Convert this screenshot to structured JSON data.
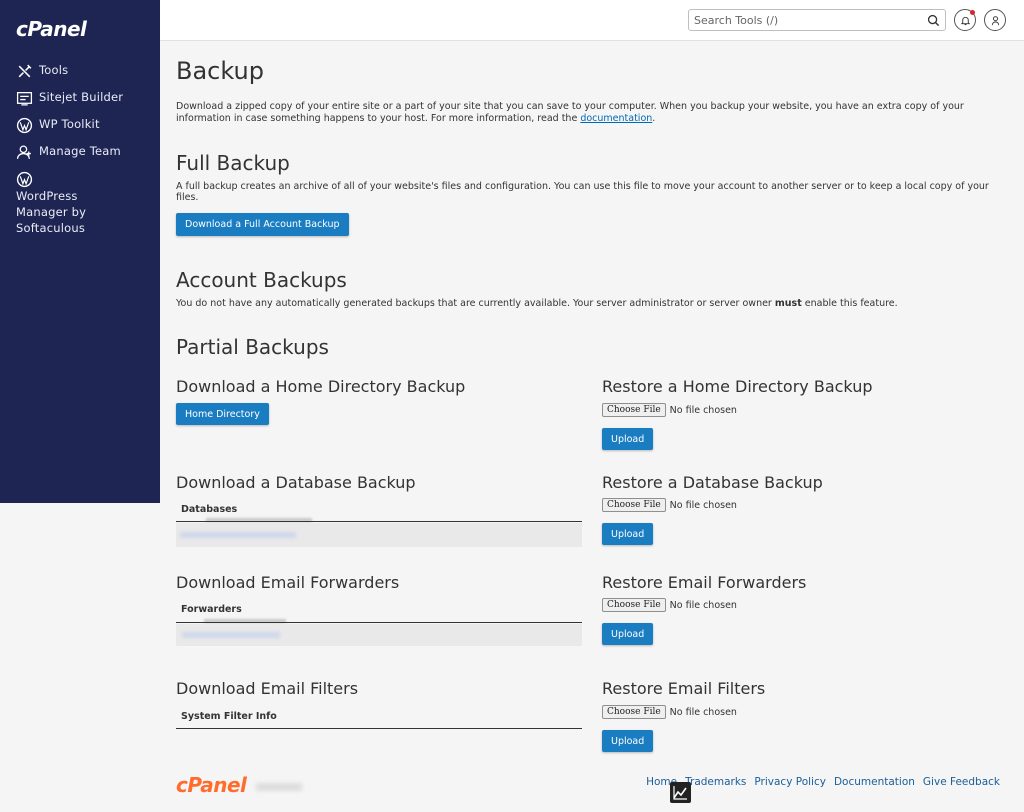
{
  "sidebar": {
    "brand": "cPanel",
    "items": [
      {
        "label": "Tools",
        "icon": "tools-icon"
      },
      {
        "label": "Sitejet Builder",
        "icon": "sitejet-icon"
      },
      {
        "label": "WP Toolkit",
        "icon": "wordpress-icon"
      },
      {
        "label": "Manage Team",
        "icon": "team-icon"
      },
      {
        "label": "WordPress Manager by Softaculous",
        "icon": "wordpress-icon"
      }
    ]
  },
  "topbar": {
    "search_placeholder": "Search Tools (/)"
  },
  "page": {
    "title": "Backup",
    "intro": "Download a zipped copy of your entire site or a part of your site that you can save to your computer. When you backup your website, you have an extra copy of your information in case something happens to your host. For more information, read the",
    "intro_link": "documentation",
    "intro_end": ".",
    "full_backup": {
      "title": "Full Backup",
      "desc": "A full backup creates an archive of all of your website's files and configuration. You can use this file to move your account to another server or to keep a local copy of your files.",
      "button": "Download a Full Account Backup"
    },
    "account_backups": {
      "title": "Account Backups",
      "desc_pre": "You do not have any automatically generated backups that are currently available. Your server administrator or server owner",
      "desc_bold": "must",
      "desc_post": "enable this feature."
    },
    "partial": {
      "title": "Partial Backups",
      "home_dl_title": "Download a Home Directory Backup",
      "home_dl_button": "Home Directory",
      "home_restore_title": "Restore a Home Directory Backup",
      "db_dl_title": "Download a Database Backup",
      "db_header": "Databases",
      "db_restore_title": "Restore a Database Backup",
      "fwd_dl_title": "Download Email Forwarders",
      "fwd_header": "Forwarders",
      "fwd_restore_title": "Restore Email Forwarders",
      "filters_dl_title": "Download Email Filters",
      "filters_header": "System Filter Info",
      "filters_restore_title": "Restore Email Filters",
      "choose_file": "Choose File",
      "no_file": "No file chosen",
      "upload": "Upload"
    }
  },
  "footer": {
    "logo": "cPanel",
    "links": [
      "Home",
      "Trademarks",
      "Privacy Policy",
      "Documentation",
      "Give Feedback"
    ]
  },
  "colors": {
    "sidebar_bg": "#1e2553",
    "primary_button": "#1a7dc2",
    "link": "#0069b4",
    "brand_orange": "#ff6c2c"
  }
}
